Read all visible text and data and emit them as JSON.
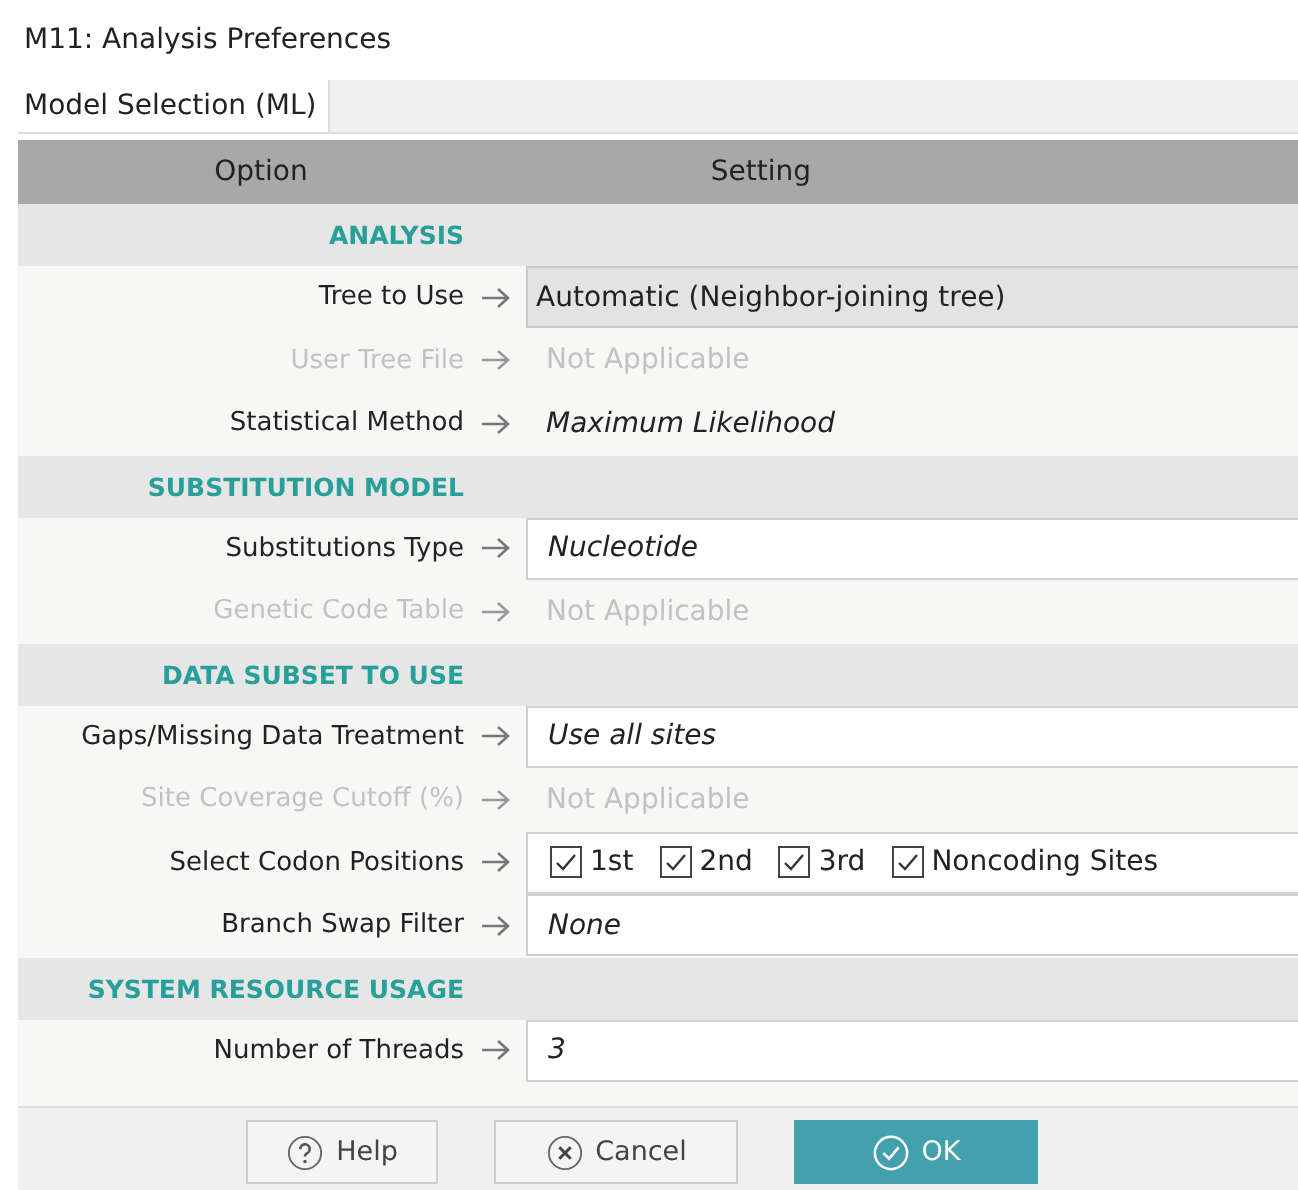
{
  "window": {
    "title": "M11: Analysis Preferences"
  },
  "tabs": [
    {
      "label": "Model Selection (ML)",
      "selected": true
    }
  ],
  "table": {
    "columns": [
      "Option",
      "Setting"
    ],
    "rows": [
      {
        "kind": "section",
        "label": "ANALYSIS"
      },
      {
        "kind": "combo",
        "label": "Tree to Use",
        "value": "Automatic (Neighbor-joining tree)",
        "disabled": false
      },
      {
        "kind": "static",
        "label": "User Tree File",
        "value": "Not Applicable",
        "disabled": true
      },
      {
        "kind": "static",
        "label": "Statistical Method",
        "value": "Maximum Likelihood",
        "disabled": false
      },
      {
        "kind": "section",
        "label": "SUBSTITUTION MODEL"
      },
      {
        "kind": "field",
        "label": "Substitutions Type",
        "value": "Nucleotide",
        "disabled": false
      },
      {
        "kind": "static",
        "label": "Genetic Code Table",
        "value": "Not Applicable",
        "disabled": true
      },
      {
        "kind": "section",
        "label": "DATA SUBSET TO USE"
      },
      {
        "kind": "field",
        "label": "Gaps/Missing Data Treatment",
        "value": "Use all sites",
        "disabled": false
      },
      {
        "kind": "static",
        "label": "Site Coverage Cutoff (%)",
        "value": "Not Applicable",
        "disabled": true
      },
      {
        "kind": "checks",
        "label": "Select Codon Positions",
        "disabled": false,
        "options": [
          {
            "label": "1st",
            "checked": true
          },
          {
            "label": "2nd",
            "checked": true
          },
          {
            "label": "3rd",
            "checked": true
          },
          {
            "label": "Noncoding Sites",
            "checked": true
          }
        ]
      },
      {
        "kind": "field",
        "label": "Branch Swap Filter",
        "value": "None",
        "disabled": false
      },
      {
        "kind": "section",
        "label": "SYSTEM RESOURCE USAGE"
      },
      {
        "kind": "field",
        "label": "Number of Threads",
        "value": "3",
        "disabled": false
      }
    ]
  },
  "buttons": [
    {
      "kind": "help",
      "label": "Help"
    },
    {
      "kind": "cancel",
      "label": "Cancel"
    },
    {
      "kind": "ok",
      "label": "OK"
    }
  ]
}
